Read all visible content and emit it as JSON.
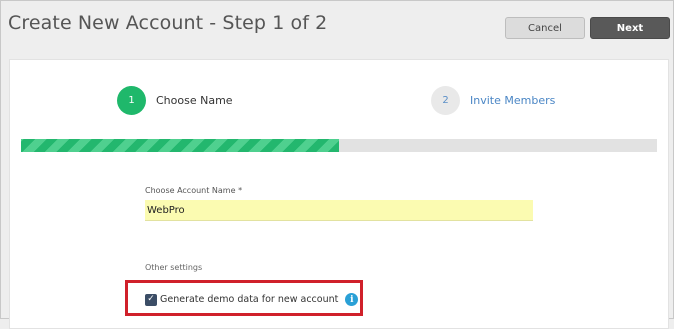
{
  "header": {
    "title": "Create New Account - Step 1 of 2",
    "cancel_label": "Cancel",
    "next_label": "Next"
  },
  "steps": [
    {
      "number": "1",
      "label": "Choose Name",
      "active": true
    },
    {
      "number": "2",
      "label": "Invite Members",
      "active": false
    }
  ],
  "progress": {
    "fraction": 0.5,
    "color": "#23b76e"
  },
  "account_name": {
    "label": "Choose Account Name *",
    "value": "WebPro"
  },
  "other_settings": {
    "label": "Other settings",
    "demo_data": {
      "label": "Generate demo data for new account",
      "checked": true,
      "info_icon": "info-icon"
    }
  },
  "colors": {
    "step_active": "#1fb86b",
    "next_button": "#595959",
    "input_bg": "#fbfbb1",
    "highlight": "#d0202a",
    "info": "#2aa0d6"
  }
}
